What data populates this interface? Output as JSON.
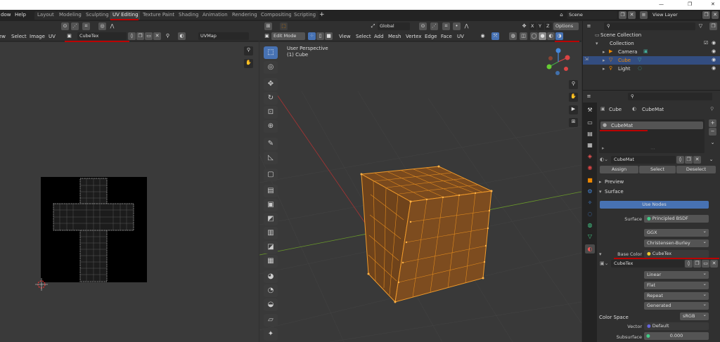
{
  "window": {
    "minimize": "—",
    "restore": "❐",
    "close": "✕"
  },
  "menu": [
    "dow",
    "Help"
  ],
  "workspaces": [
    {
      "label": "Layout",
      "active": false
    },
    {
      "label": "Modeling",
      "active": false
    },
    {
      "label": "Sculpting",
      "active": false
    },
    {
      "label": "UV Editing",
      "active": true
    },
    {
      "label": "Texture Paint",
      "active": false
    },
    {
      "label": "Shading",
      "active": false
    },
    {
      "label": "Animation",
      "active": false
    },
    {
      "label": "Rendering",
      "active": false
    },
    {
      "label": "Compositing",
      "active": false
    },
    {
      "label": "Scripting",
      "active": false
    }
  ],
  "add_workspace": "+",
  "scene": {
    "label": "Scene",
    "view_layer": "View Layer"
  },
  "uv_editor": {
    "menus": [
      "ew",
      "Select",
      "Image",
      "UV"
    ],
    "image_name": "CubeTex",
    "uv_map": "UVMap"
  },
  "viewport": {
    "mode": "Edit Mode",
    "menus": [
      "View",
      "Select",
      "Add",
      "Mesh",
      "Vertex",
      "Edge",
      "Face",
      "UV"
    ],
    "transform": "Global",
    "options": "Options",
    "axes": [
      "X",
      "Y",
      "Z"
    ],
    "overlay_title": "User Perspective",
    "overlay_object": "(1) Cube"
  },
  "outliner": {
    "collection_root": "Scene Collection",
    "collection": "Collection",
    "items": [
      {
        "label": "Camera",
        "selected": false
      },
      {
        "label": "Cube",
        "selected": true
      },
      {
        "label": "Light",
        "selected": false
      }
    ]
  },
  "properties": {
    "object": "Cube",
    "material": "CubeMat",
    "slot": "CubeMat",
    "material_field": "CubeMat",
    "assign": "Assign",
    "select": "Select",
    "deselect": "Deselect",
    "preview": "Preview",
    "surface_panel": "Surface",
    "use_nodes": "Use Nodes",
    "surface_label": "Surface",
    "surface_value": "Principled BSDF",
    "distribution": "GGX",
    "subsurface_method": "Christensen-Burley",
    "base_color_label": "Base Color",
    "base_color_value": "CubeTex",
    "image_field": "CubeTex",
    "interpolation": "Linear",
    "projection": "Flat",
    "extension": "Repeat",
    "source": "Generated",
    "color_space_label": "Color Space",
    "color_space_value": "sRGB",
    "vector_label": "Vector",
    "vector_value": "Default",
    "subsurface_label": "Subsurface",
    "subsurface_value": "0.000"
  },
  "colors": {
    "accent": "#4772b3",
    "mesh": "#e08a1e",
    "highlight": "#b00000"
  }
}
